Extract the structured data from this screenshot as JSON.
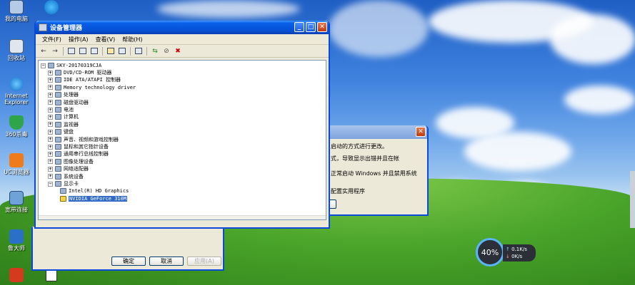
{
  "desktop": {
    "icons": [
      {
        "label": "我的电脑",
        "name": "my-computer"
      },
      {
        "label": "回收站",
        "name": "recycle-bin"
      },
      {
        "label": "Internet Explorer",
        "name": "internet-explorer"
      },
      {
        "label": "360杀毒",
        "name": "360-antivirus"
      },
      {
        "label": "UC浏览器",
        "name": "uc-browser"
      },
      {
        "label": "宽带连接",
        "name": "broadband"
      },
      {
        "label": "鲁大师",
        "name": "ludashi"
      },
      {
        "label": "",
        "name": "bottom-app"
      }
    ]
  },
  "colors": {
    "titlebar": "#0452d6",
    "selection": "#316ac5",
    "close": "#c2390d",
    "gauge_ring": "#5ab4ff"
  },
  "device_manager": {
    "title": "设备管理器",
    "menus": [
      "文件(F)",
      "操作(A)",
      "查看(V)",
      "帮助(H)"
    ],
    "toolbar_icons": [
      "back-arrow-icon",
      "forward-arrow-icon",
      "properties-icon",
      "tree-view-icon",
      "print-icon",
      "help-icon",
      "properties-sheet-icon",
      "scan-hardware-icon",
      "update-driver-icon",
      "disable-device-icon",
      "uninstall-device-icon"
    ],
    "tree": {
      "root": "SKY-20170319CJA",
      "categories": [
        "DVD/CD-ROM 驱动器",
        "IDE ATA/ATAPI 控制器",
        "Memory technology driver",
        "处理器",
        "磁盘驱动器",
        "电池",
        "计算机",
        "监视器",
        "键盘",
        "声音、视频和游戏控制器",
        "鼠标和其它指针设备",
        "通用串行总线控制器",
        "图像处理设备",
        "网络适配器",
        "系统设备",
        "显示卡"
      ],
      "display_children": [
        "Intel(R) HD Graphics",
        "NVIDIA GeForce 310M"
      ],
      "selected": "NVIDIA GeForce 310M"
    }
  },
  "back_dialog": {
    "lines": [
      "启动的方式进行更改。",
      "式，导致显示出错并且在帐",
      "正常启动 Windows 并且禁用系统",
      "配置实用程序"
    ],
    "buttons": {
      "ok": "确定",
      "cancel": "取消",
      "apply": "应用(A)"
    }
  },
  "net_monitor": {
    "percent": "40%",
    "upload": "0.1K/s",
    "download": "0K/s"
  }
}
